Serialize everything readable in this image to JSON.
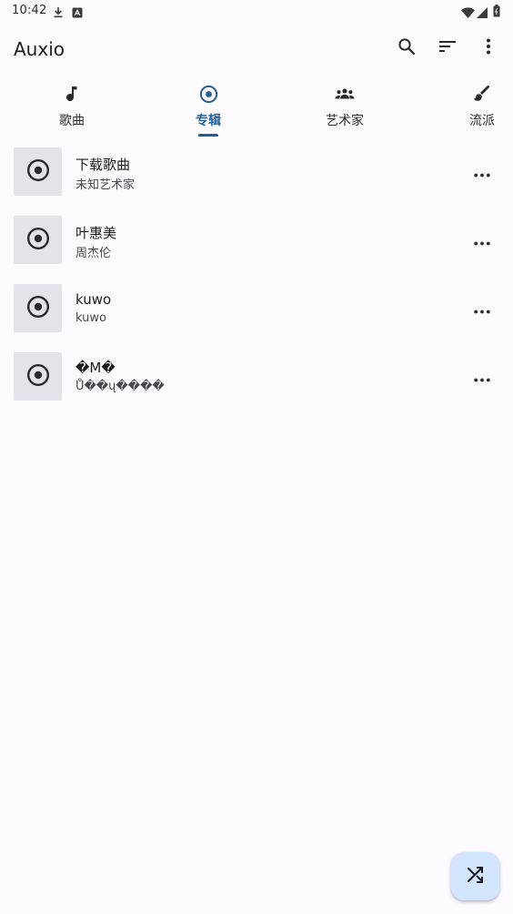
{
  "status_bar": {
    "time": "10:42",
    "icons": [
      "download-icon",
      "notification-icon",
      "wifi-icon",
      "cell-signal-icon",
      "battery-icon"
    ]
  },
  "app_bar": {
    "title": "Auxio",
    "actions": [
      "search-icon",
      "sort-icon",
      "more-vert-icon"
    ]
  },
  "tabs": [
    {
      "label": "歌曲",
      "icon": "music-note-icon",
      "active": false
    },
    {
      "label": "专辑",
      "icon": "album-icon",
      "active": true
    },
    {
      "label": "艺术家",
      "icon": "artist-group-icon",
      "active": false
    },
    {
      "label": "流派",
      "icon": "genre-brush-icon",
      "active": false
    }
  ],
  "albums": [
    {
      "name": "下载歌曲",
      "artist": "未知艺术家"
    },
    {
      "name": "叶惠美",
      "artist": "周杰伦"
    },
    {
      "name": "kuwo",
      "artist": "kuwo"
    },
    {
      "name": "�M�",
      "artist": "Ů��ų����"
    }
  ],
  "fab": {
    "icon": "shuffle-icon"
  },
  "colors": {
    "accent": "#1d5f98",
    "background": "#fdfbff",
    "fab_background": "#d3e4ff",
    "cover_placeholder": "#e5e3ea"
  }
}
